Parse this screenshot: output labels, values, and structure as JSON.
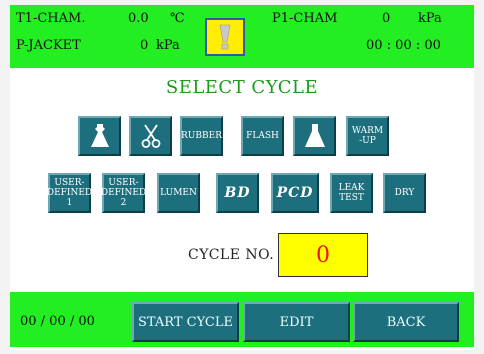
{
  "status_bar": {
    "t1_label": "T1-CHAM.",
    "t1_value": "0.0",
    "t1_unit": "℃",
    "p1_label": "P1-CHAM",
    "p1_value": "0",
    "p1_unit": "kPa",
    "jacket_label": "P-JACKET",
    "jacket_value": "0",
    "jacket_unit": "kPa",
    "time": "00 : 00 : 00",
    "warning_icon": "exclamation-icon"
  },
  "title": "SELECT CYCLE",
  "cycle_buttons_row1": [
    {
      "name": "textile-icon",
      "label": ""
    },
    {
      "name": "scissors-icon",
      "label": ""
    },
    {
      "name": "rubber",
      "label": "RUBBER"
    },
    {
      "name": "flash",
      "label": "FLASH"
    },
    {
      "name": "flask-icon",
      "label": ""
    },
    {
      "name": "warm-up",
      "label": "WARM\n-UP"
    }
  ],
  "cycle_buttons_row2": [
    {
      "name": "user-defined-1",
      "label": "USER-\nDEFINED\n1"
    },
    {
      "name": "user-defined-2",
      "label": "USER-\nDEFINED\n2"
    },
    {
      "name": "lumen",
      "label": "LUMEN"
    },
    {
      "name": "bd",
      "label": "BD"
    },
    {
      "name": "pcd",
      "label": "PCD"
    },
    {
      "name": "leak-test",
      "label": "LEAK\nTEST"
    },
    {
      "name": "dry",
      "label": "DRY"
    }
  ],
  "cycle_no": {
    "label": "CYCLE NO.",
    "value": "0"
  },
  "bottom_bar": {
    "date": "00 / 00 / 00",
    "start_label": "START CYCLE",
    "edit_label": "EDIT",
    "back_label": "BACK"
  },
  "colors": {
    "bar_green": "#22ee22",
    "button_teal": "#1e6f7d",
    "title_green": "#1b9c1b",
    "highlight_yellow": "#ffff00",
    "value_red": "#ee1111"
  }
}
